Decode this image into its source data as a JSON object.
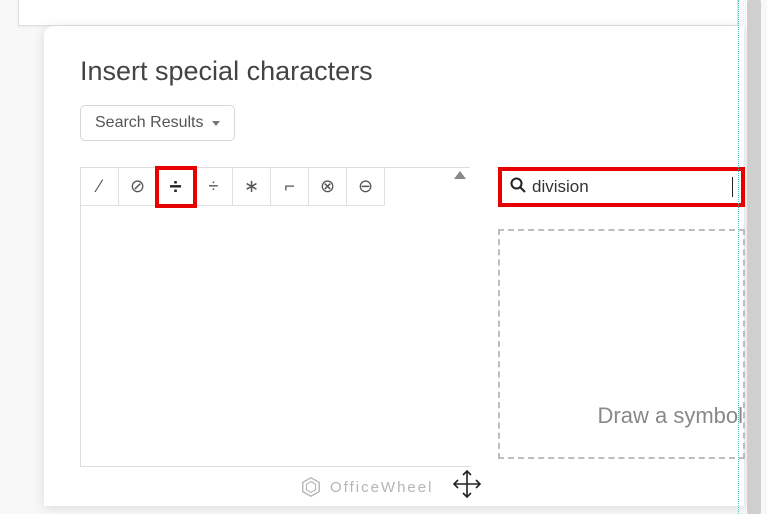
{
  "dialog": {
    "title": "Insert special characters",
    "dropdown_label": "Search Results"
  },
  "chars": [
    "∕",
    "⊘",
    "÷",
    "÷",
    "∗",
    "⌐",
    "⊗",
    "⊖"
  ],
  "highlight_index": 2,
  "search": {
    "value": "division",
    "icon": "search-icon"
  },
  "draw": {
    "hint": "Draw a symbol"
  },
  "watermark": {
    "text": "OfficeWheel"
  }
}
